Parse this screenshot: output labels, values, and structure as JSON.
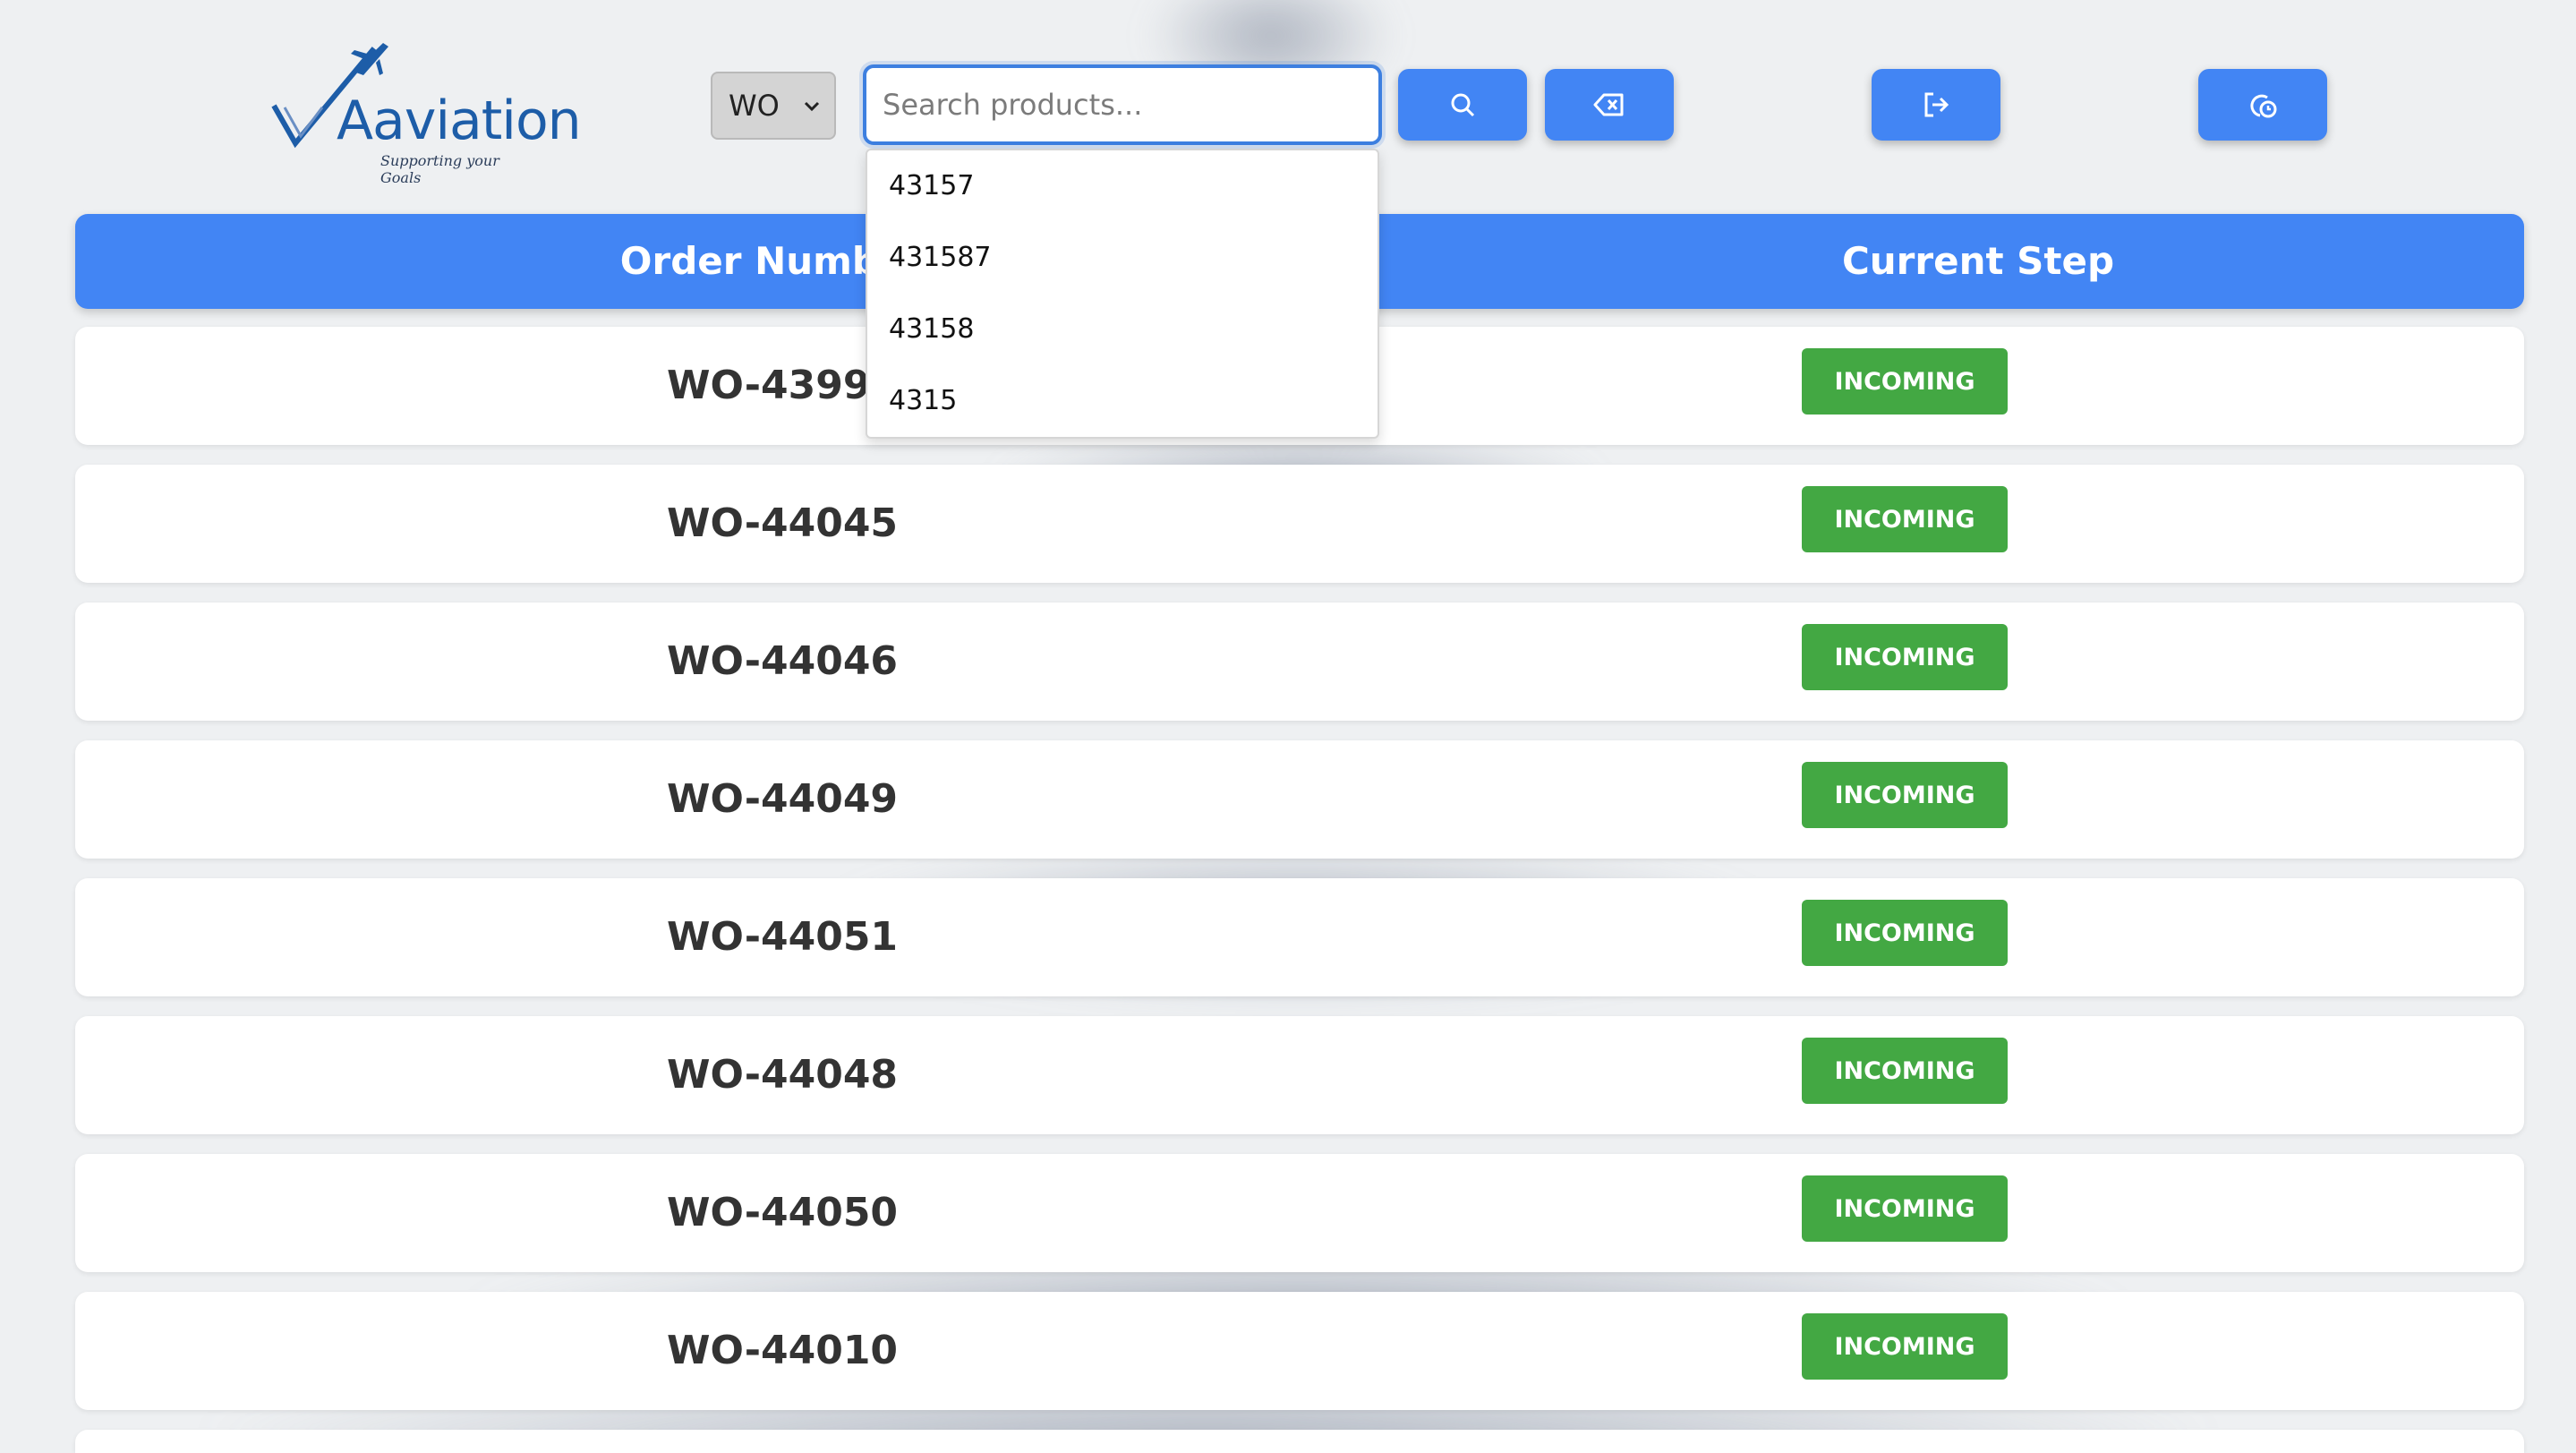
{
  "brand": {
    "name": "Aaviation",
    "tagline": "Supporting your Goals",
    "colors": {
      "primary": "#4285f4",
      "logo_blue": "#1d5da8",
      "badge_green": "#43a843"
    }
  },
  "toolbar": {
    "type_select": {
      "value": "WO",
      "icon": "chevron-down-icon"
    },
    "search": {
      "placeholder": "Search products...",
      "value": ""
    },
    "buttons": [
      {
        "name": "search-button",
        "icon": "search-icon"
      },
      {
        "name": "clear-button",
        "icon": "backspace-icon"
      },
      {
        "name": "logout-button",
        "icon": "sign-out-icon"
      },
      {
        "name": "history-button",
        "icon": "clock-history-icon"
      }
    ]
  },
  "suggestions": [
    "43157",
    "431587",
    "43158",
    "4315"
  ],
  "table": {
    "columns": [
      "Order Number",
      "Current Step"
    ],
    "rows": [
      {
        "order": "WO-43999",
        "step": "INCOMING"
      },
      {
        "order": "WO-44045",
        "step": "INCOMING"
      },
      {
        "order": "WO-44046",
        "step": "INCOMING"
      },
      {
        "order": "WO-44049",
        "step": "INCOMING"
      },
      {
        "order": "WO-44051",
        "step": "INCOMING"
      },
      {
        "order": "WO-44048",
        "step": "INCOMING"
      },
      {
        "order": "WO-44050",
        "step": "INCOMING"
      },
      {
        "order": "WO-44010",
        "step": "INCOMING"
      }
    ]
  }
}
